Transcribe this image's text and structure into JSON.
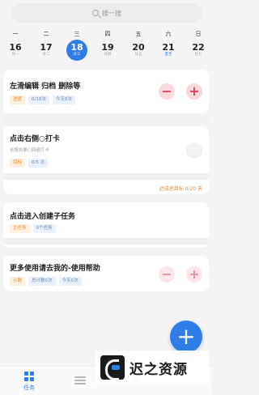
{
  "search": {
    "placeholder": "搜一搜"
  },
  "calendar": {
    "days": [
      {
        "weekday": "一",
        "num": "16",
        "lunar": "廿一"
      },
      {
        "weekday": "二",
        "num": "17",
        "lunar": "廿二"
      },
      {
        "weekday": "三",
        "num": "18",
        "lunar": "廿三",
        "selected": true
      },
      {
        "weekday": "四",
        "num": "19",
        "lunar": "廿四"
      },
      {
        "weekday": "五",
        "num": "20",
        "lunar": "廿五"
      },
      {
        "weekday": "六",
        "num": "21",
        "lunar": "夏至"
      },
      {
        "weekday": "日",
        "num": "22",
        "lunar": "廿七"
      }
    ]
  },
  "cards": {
    "c1": {
      "title": "左滑编辑 归档 删除等",
      "tags": [
        "进度",
        "0/10次",
        "今天0次"
      ],
      "minus": "−",
      "plus": "+"
    },
    "c2": {
      "title": "点击右侧○打卡",
      "subtitle": "长按右侧○回退打卡",
      "tags": [
        "目标",
        "0/5 次"
      ],
      "goal": "达成总目标 0/20 天"
    },
    "c3": {
      "title": "点击进入创建子任务",
      "tags": [
        "主任务",
        "0个任务"
      ]
    },
    "c4": {
      "title": "更多使用请去我的-使用帮助",
      "tags": [
        "计数",
        "总计数0次",
        "今天0次"
      ],
      "minus": "−",
      "plus": "+"
    }
  },
  "fab": {
    "label": "+"
  },
  "tabbar": {
    "tasks_label": "任务"
  },
  "watermark": {
    "text": "迟之资源"
  },
  "colors": {
    "accent": "#2f7ee8",
    "warn": "#e58a2a",
    "danger": "#d5455d"
  }
}
